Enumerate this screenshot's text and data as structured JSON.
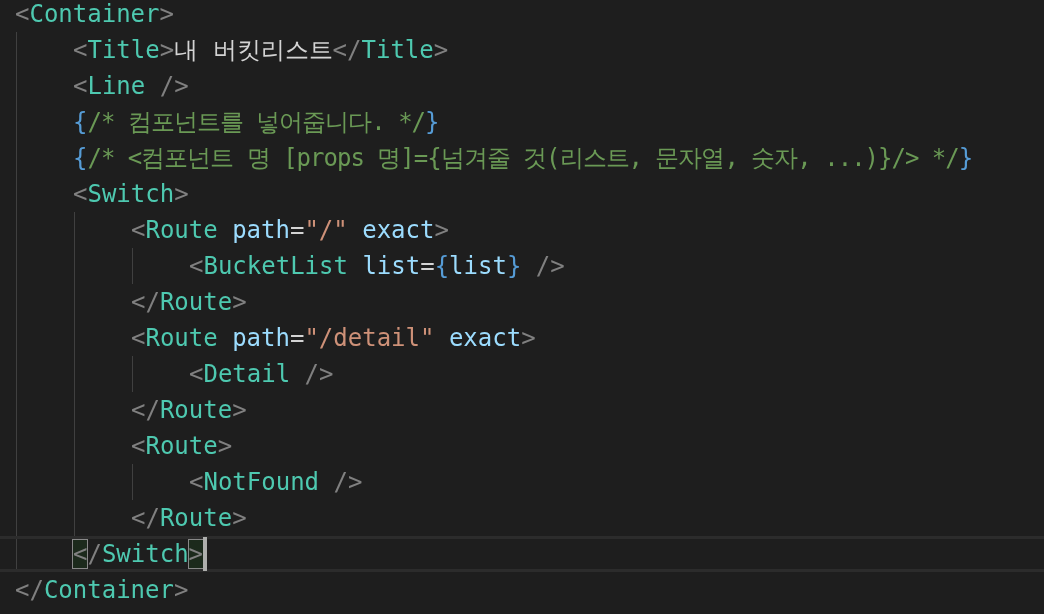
{
  "code": [
    {
      "current": false,
      "tokens": [
        {
          "kind": "bracket",
          "text": "<"
        },
        {
          "kind": "tag",
          "text": "Container"
        },
        {
          "kind": "bracket",
          "text": ">"
        }
      ],
      "children": [
        {
          "current": false,
          "tokens": [
            {
              "kind": "bracket",
              "text": "<"
            },
            {
              "kind": "tag",
              "text": "Title"
            },
            {
              "kind": "bracket",
              "text": ">"
            },
            {
              "kind": "text",
              "text": "내 버킷리스트"
            },
            {
              "kind": "bracket",
              "text": "</"
            },
            {
              "kind": "tag",
              "text": "Title"
            },
            {
              "kind": "bracket",
              "text": ">"
            }
          ]
        },
        {
          "current": false,
          "tokens": [
            {
              "kind": "bracket",
              "text": "<"
            },
            {
              "kind": "tag",
              "text": "Line"
            },
            {
              "kind": "bracket",
              "text": " />"
            }
          ]
        },
        {
          "current": false,
          "tokens": [
            {
              "kind": "brace",
              "text": "{"
            },
            {
              "kind": "comment",
              "text": "/* 컴포넌트를 넣어줍니다. */"
            },
            {
              "kind": "brace",
              "text": "}"
            }
          ]
        },
        {
          "current": false,
          "tokens": [
            {
              "kind": "brace",
              "text": "{"
            },
            {
              "kind": "comment",
              "text": "/* <컴포넌트 명 [props 명]={넘겨줄 것(리스트, 문자열, 숫자, ...)}/> */"
            },
            {
              "kind": "brace",
              "text": "}"
            }
          ]
        },
        {
          "current": false,
          "tokens": [
            {
              "kind": "bracket",
              "text": "<"
            },
            {
              "kind": "tag",
              "text": "Switch"
            },
            {
              "kind": "bracket",
              "text": ">"
            }
          ],
          "children": [
            {
              "current": false,
              "tokens": [
                {
                  "kind": "bracket",
                  "text": "<"
                },
                {
                  "kind": "tag",
                  "text": "Route"
                },
                {
                  "kind": "attr",
                  "text": " path"
                },
                {
                  "kind": "punct",
                  "text": "="
                },
                {
                  "kind": "string",
                  "text": "\"/\""
                },
                {
                  "kind": "attr",
                  "text": " exact"
                },
                {
                  "kind": "bracket",
                  "text": ">"
                }
              ],
              "children": [
                {
                  "current": false,
                  "tokens": [
                    {
                      "kind": "bracket",
                      "text": "<"
                    },
                    {
                      "kind": "tag",
                      "text": "BucketList"
                    },
                    {
                      "kind": "attr",
                      "text": " list"
                    },
                    {
                      "kind": "punct",
                      "text": "="
                    },
                    {
                      "kind": "brace",
                      "text": "{"
                    },
                    {
                      "kind": "attr",
                      "text": "list"
                    },
                    {
                      "kind": "brace",
                      "text": "}"
                    },
                    {
                      "kind": "bracket",
                      "text": " />"
                    }
                  ]
                }
              ]
            },
            {
              "current": false,
              "tokens": [
                {
                  "kind": "bracket",
                  "text": "</"
                },
                {
                  "kind": "tag",
                  "text": "Route"
                },
                {
                  "kind": "bracket",
                  "text": ">"
                }
              ]
            },
            {
              "current": false,
              "tokens": [
                {
                  "kind": "bracket",
                  "text": "<"
                },
                {
                  "kind": "tag",
                  "text": "Route"
                },
                {
                  "kind": "attr",
                  "text": " path"
                },
                {
                  "kind": "punct",
                  "text": "="
                },
                {
                  "kind": "string",
                  "text": "\"/detail\""
                },
                {
                  "kind": "attr",
                  "text": " exact"
                },
                {
                  "kind": "bracket",
                  "text": ">"
                }
              ],
              "children": [
                {
                  "current": false,
                  "tokens": [
                    {
                      "kind": "bracket",
                      "text": "<"
                    },
                    {
                      "kind": "tag",
                      "text": "Detail"
                    },
                    {
                      "kind": "bracket",
                      "text": " />"
                    }
                  ]
                }
              ]
            },
            {
              "current": false,
              "tokens": [
                {
                  "kind": "bracket",
                  "text": "</"
                },
                {
                  "kind": "tag",
                  "text": "Route"
                },
                {
                  "kind": "bracket",
                  "text": ">"
                }
              ]
            },
            {
              "current": false,
              "tokens": [
                {
                  "kind": "bracket",
                  "text": "<"
                },
                {
                  "kind": "tag",
                  "text": "Route"
                },
                {
                  "kind": "bracket",
                  "text": ">"
                }
              ],
              "children": [
                {
                  "current": false,
                  "tokens": [
                    {
                      "kind": "bracket",
                      "text": "<"
                    },
                    {
                      "kind": "tag",
                      "text": "NotFound"
                    },
                    {
                      "kind": "bracket",
                      "text": " />"
                    }
                  ]
                }
              ]
            },
            {
              "current": false,
              "tokens": [
                {
                  "kind": "bracket",
                  "text": "</"
                },
                {
                  "kind": "tag",
                  "text": "Route"
                },
                {
                  "kind": "bracket",
                  "text": ">"
                }
              ]
            }
          ]
        },
        {
          "current": true,
          "tokens": [
            {
              "kind": "bracket",
              "text": "<"
            },
            {
              "kind": "bracket",
              "text": "/"
            },
            {
              "kind": "tag",
              "text": "Switch"
            },
            {
              "kind": "bracket",
              "text": ">"
            }
          ]
        }
      ]
    },
    {
      "current": false,
      "tokens": [
        {
          "kind": "bracket",
          "text": "</"
        },
        {
          "kind": "tag",
          "text": "Container"
        },
        {
          "kind": "bracket",
          "text": ">"
        }
      ]
    }
  ]
}
